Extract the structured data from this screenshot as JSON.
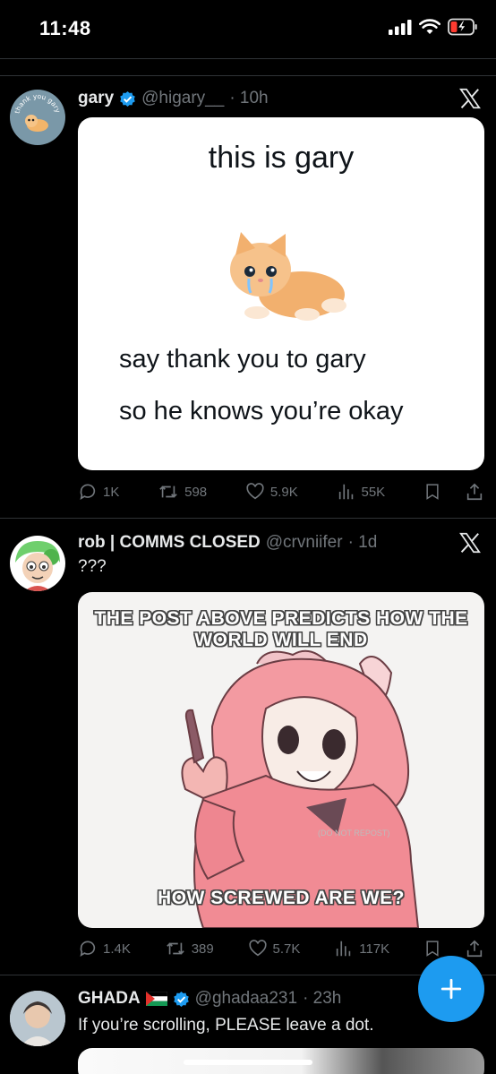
{
  "status_bar": {
    "time": "11:48"
  },
  "posts": [
    {
      "name": "gary",
      "handle": "@higary__",
      "time": "· 10h",
      "text": "",
      "media": {
        "line1": "this is gary",
        "line2": "say thank you to gary",
        "line3": "so he knows you’re okay"
      },
      "avatar_text": "thank you gary",
      "stats": {
        "replies": "1K",
        "reposts": "598",
        "likes": "5.9K",
        "views": "55K"
      }
    },
    {
      "name": "rob | COMMS CLOSED",
      "handle": "@crvniifer",
      "time": "· 1d",
      "text": "???",
      "media": {
        "top": "THE POST ABOVE PREDICTS HOW THE WORLD WILL END",
        "bottom": "HOW SCREWED ARE WE?",
        "watermark": "(DO NOT REPOST)"
      },
      "stats": {
        "replies": "1.4K",
        "reposts": "389",
        "likes": "5.7K",
        "views": "117K"
      }
    },
    {
      "name": "GHADA",
      "handle": "@ghadaa231",
      "time": "· 23h",
      "text": "If you’re scrolling, PLEASE leave a dot."
    }
  ],
  "fab": {
    "icon": "plus-icon"
  },
  "colors": {
    "accent": "#1d9bf0",
    "muted": "#71767b",
    "text": "#e7e9ea",
    "divider": "#2f3336"
  }
}
